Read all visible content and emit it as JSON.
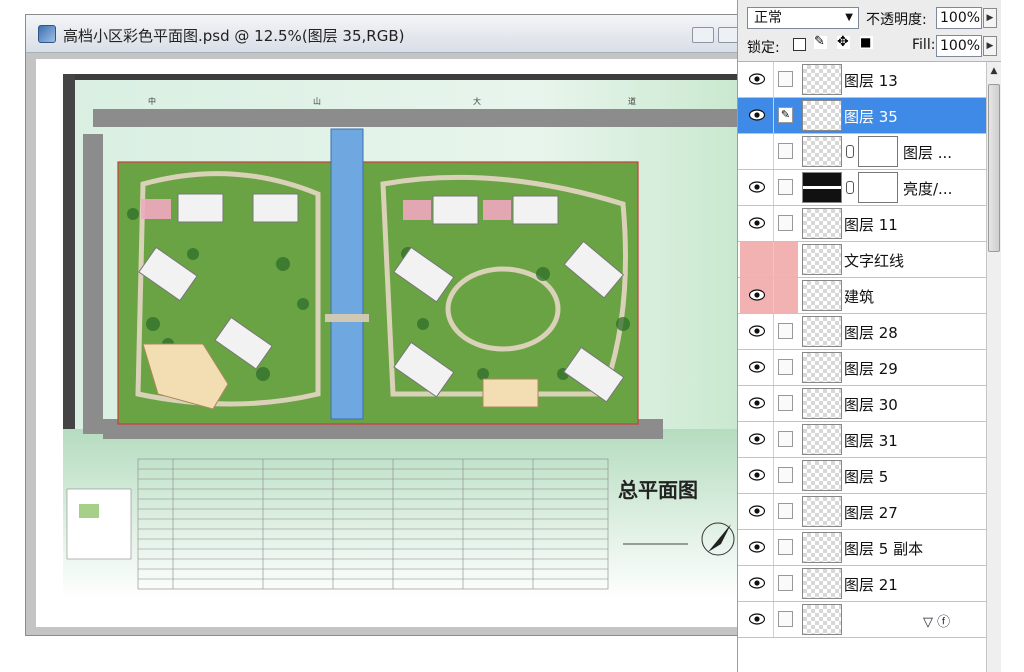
{
  "document": {
    "title": "高档小区彩色平面图.psd @ 12.5%(图层 35,RGB)",
    "plan_title": "总平面图",
    "road_labels": [
      "中",
      "山",
      "大",
      "道"
    ]
  },
  "options": {
    "blend_mode": "正常",
    "opacity_label": "不透明度:",
    "opacity_value": "100%",
    "lock_label": "锁定:",
    "fill_label": "Fill:",
    "fill_value": "100%"
  },
  "layers": [
    {
      "name": "图层 13",
      "visible": true
    },
    {
      "name": "图层 35",
      "visible": true,
      "selected": true
    },
    {
      "name": "图层 ...",
      "visible": false,
      "mask": true
    },
    {
      "name": "亮度/...",
      "visible": true,
      "mask": true,
      "adjust": true
    },
    {
      "name": "图层 11",
      "visible": true
    },
    {
      "name": "文字红线",
      "visible": false,
      "red": true
    },
    {
      "name": "建筑",
      "visible": true,
      "red": true
    },
    {
      "name": "图层 28",
      "visible": true
    },
    {
      "name": "图层 29",
      "visible": true
    },
    {
      "name": "图层 30",
      "visible": true
    },
    {
      "name": "图层 31",
      "visible": true
    },
    {
      "name": "图层 5",
      "visible": true
    },
    {
      "name": "图层 27",
      "visible": true
    },
    {
      "name": "图层 5 副本",
      "visible": true
    },
    {
      "name": "图层 21",
      "visible": true
    },
    {
      "name": "",
      "visible": true
    }
  ],
  "colors": {
    "selected_row": "#3e8ae6",
    "red_flag": "#f3b2b2",
    "lawn": "#79b24a",
    "water": "#6fa7e0",
    "road": "#8c8c8c"
  }
}
